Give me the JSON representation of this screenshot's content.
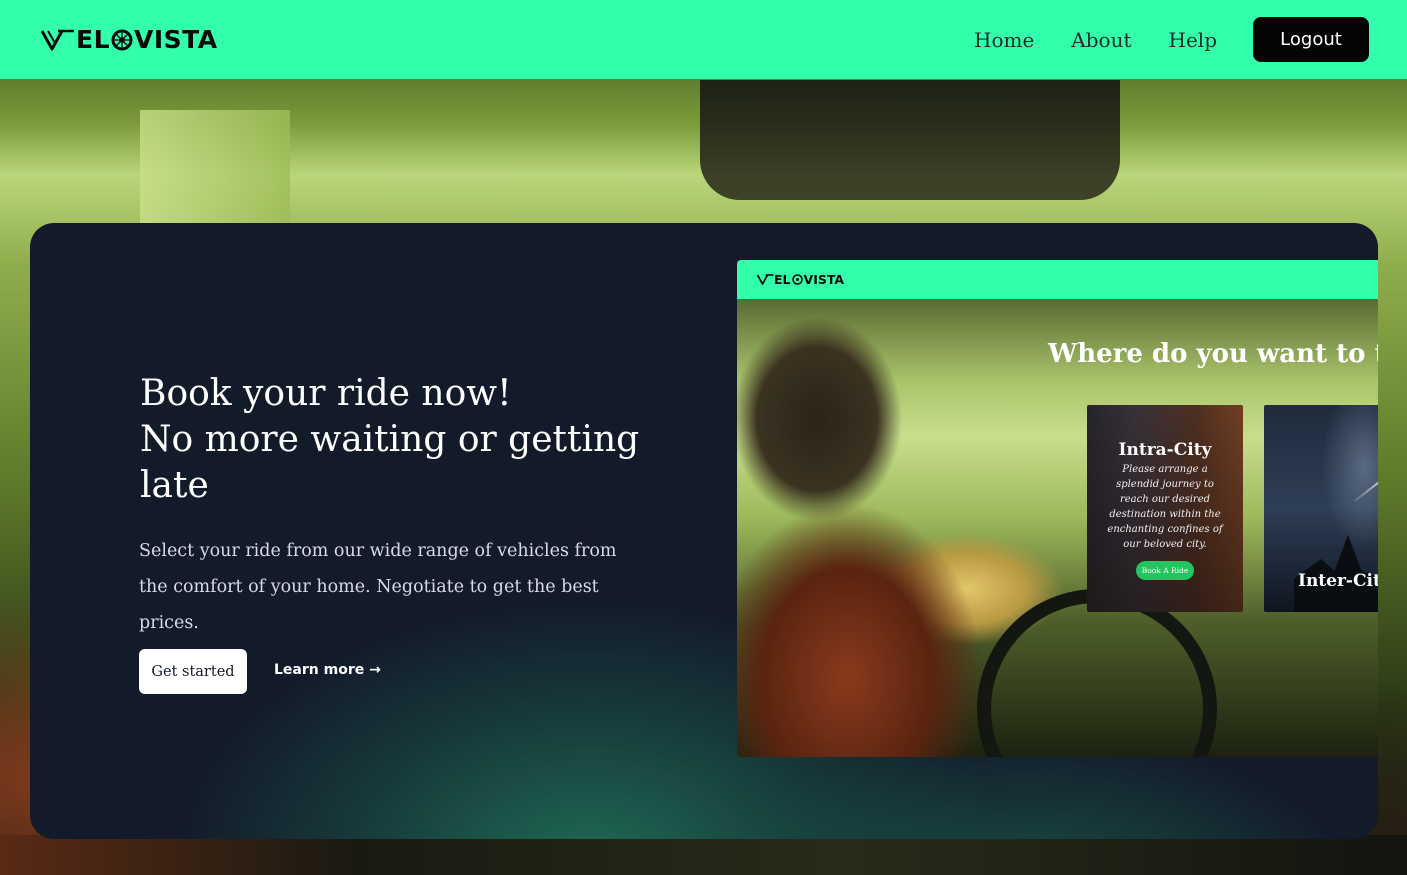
{
  "brand": {
    "logo_text": "VELOVISTA",
    "logo_prefix": "EL",
    "logo_suffix": "VISTA",
    "accent_color": "#33ffaa"
  },
  "nav": {
    "links": [
      {
        "label": "Home"
      },
      {
        "label": "About"
      },
      {
        "label": "Help"
      }
    ],
    "logout_label": "Logout"
  },
  "hero": {
    "headline_lines": [
      "Book your ride now!",
      "No more waiting or getting late"
    ],
    "description": "Select your ride from our wide range of vehicles from the comfort of your home. Negotiate to get the best prices.",
    "primary_cta": "Get started",
    "secondary_cta": "Learn more →",
    "card_color": "#131a2a"
  },
  "preview": {
    "logo_prefix": "EL",
    "logo_suffix": "VISTA",
    "title": "Where do you want to t",
    "cards": [
      {
        "title": "Intra-City",
        "description": "Please arrange a splendid journey to reach our desired destination within the enchanting confines of our beloved city.",
        "button_label": "Book A Ride",
        "button_color": "#22c55e"
      },
      {
        "title": "Inter-Cit"
      }
    ]
  },
  "icons": {
    "logo_v": "v-chevron-icon",
    "logo_o": "wheel-icon"
  }
}
